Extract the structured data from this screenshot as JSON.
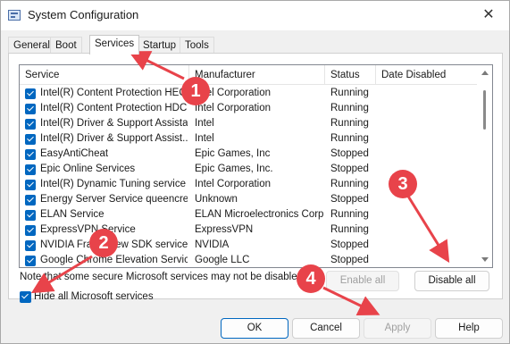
{
  "window": {
    "title": "System Configuration",
    "close_glyph": "✕"
  },
  "tabs": [
    {
      "label": "General"
    },
    {
      "label": "Boot"
    },
    {
      "label": "Services"
    },
    {
      "label": "Startup"
    },
    {
      "label": "Tools"
    }
  ],
  "active_tab": "Services",
  "services": {
    "columns": [
      "Service",
      "Manufacturer",
      "Status",
      "Date Disabled"
    ],
    "rows": [
      {
        "service": "Intel(R) Content Protection HEC...",
        "manufacturer": "Intel Corporation",
        "status": "Running",
        "checked": true
      },
      {
        "service": "Intel(R) Content Protection HDC...",
        "manufacturer": "Intel Corporation",
        "status": "Running",
        "checked": true
      },
      {
        "service": "Intel(R) Driver & Support Assistant",
        "manufacturer": "Intel",
        "status": "Running",
        "checked": true
      },
      {
        "service": "Intel(R) Driver & Support Assist...",
        "manufacturer": "Intel",
        "status": "Running",
        "checked": true
      },
      {
        "service": "EasyAntiCheat",
        "manufacturer": "Epic Games, Inc",
        "status": "Stopped",
        "checked": true
      },
      {
        "service": "Epic Online Services",
        "manufacturer": "Epic Games, Inc.",
        "status": "Stopped",
        "checked": true
      },
      {
        "service": "Intel(R) Dynamic Tuning service",
        "manufacturer": "Intel Corporation",
        "status": "Running",
        "checked": true
      },
      {
        "service": "Energy Server Service queencreek",
        "manufacturer": "Unknown",
        "status": "Stopped",
        "checked": true
      },
      {
        "service": "ELAN Service",
        "manufacturer": "ELAN Microelectronics Corp.",
        "status": "Running",
        "checked": true
      },
      {
        "service": "ExpressVPN Service",
        "manufacturer": "ExpressVPN",
        "status": "Running",
        "checked": true
      },
      {
        "service": "NVIDIA FrameView SDK service",
        "manufacturer": "NVIDIA",
        "status": "Stopped",
        "checked": true
      },
      {
        "service": "Google Chrome Elevation Servic...",
        "manufacturer": "Google LLC",
        "status": "Stopped",
        "checked": true
      }
    ]
  },
  "note": "Note that some secure Microsoft services may not be disabled.",
  "buttons": {
    "enable_all": "Enable all",
    "disable_all": "Disable all",
    "ok": "OK",
    "cancel": "Cancel",
    "apply": "Apply",
    "help": "Help"
  },
  "hide_ms": {
    "label": "Hide all Microsoft services",
    "checked": true
  },
  "annotations": [
    "1",
    "2",
    "3",
    "4"
  ],
  "colors": {
    "accent": "#0067c0",
    "annotation": "#e8434a"
  }
}
